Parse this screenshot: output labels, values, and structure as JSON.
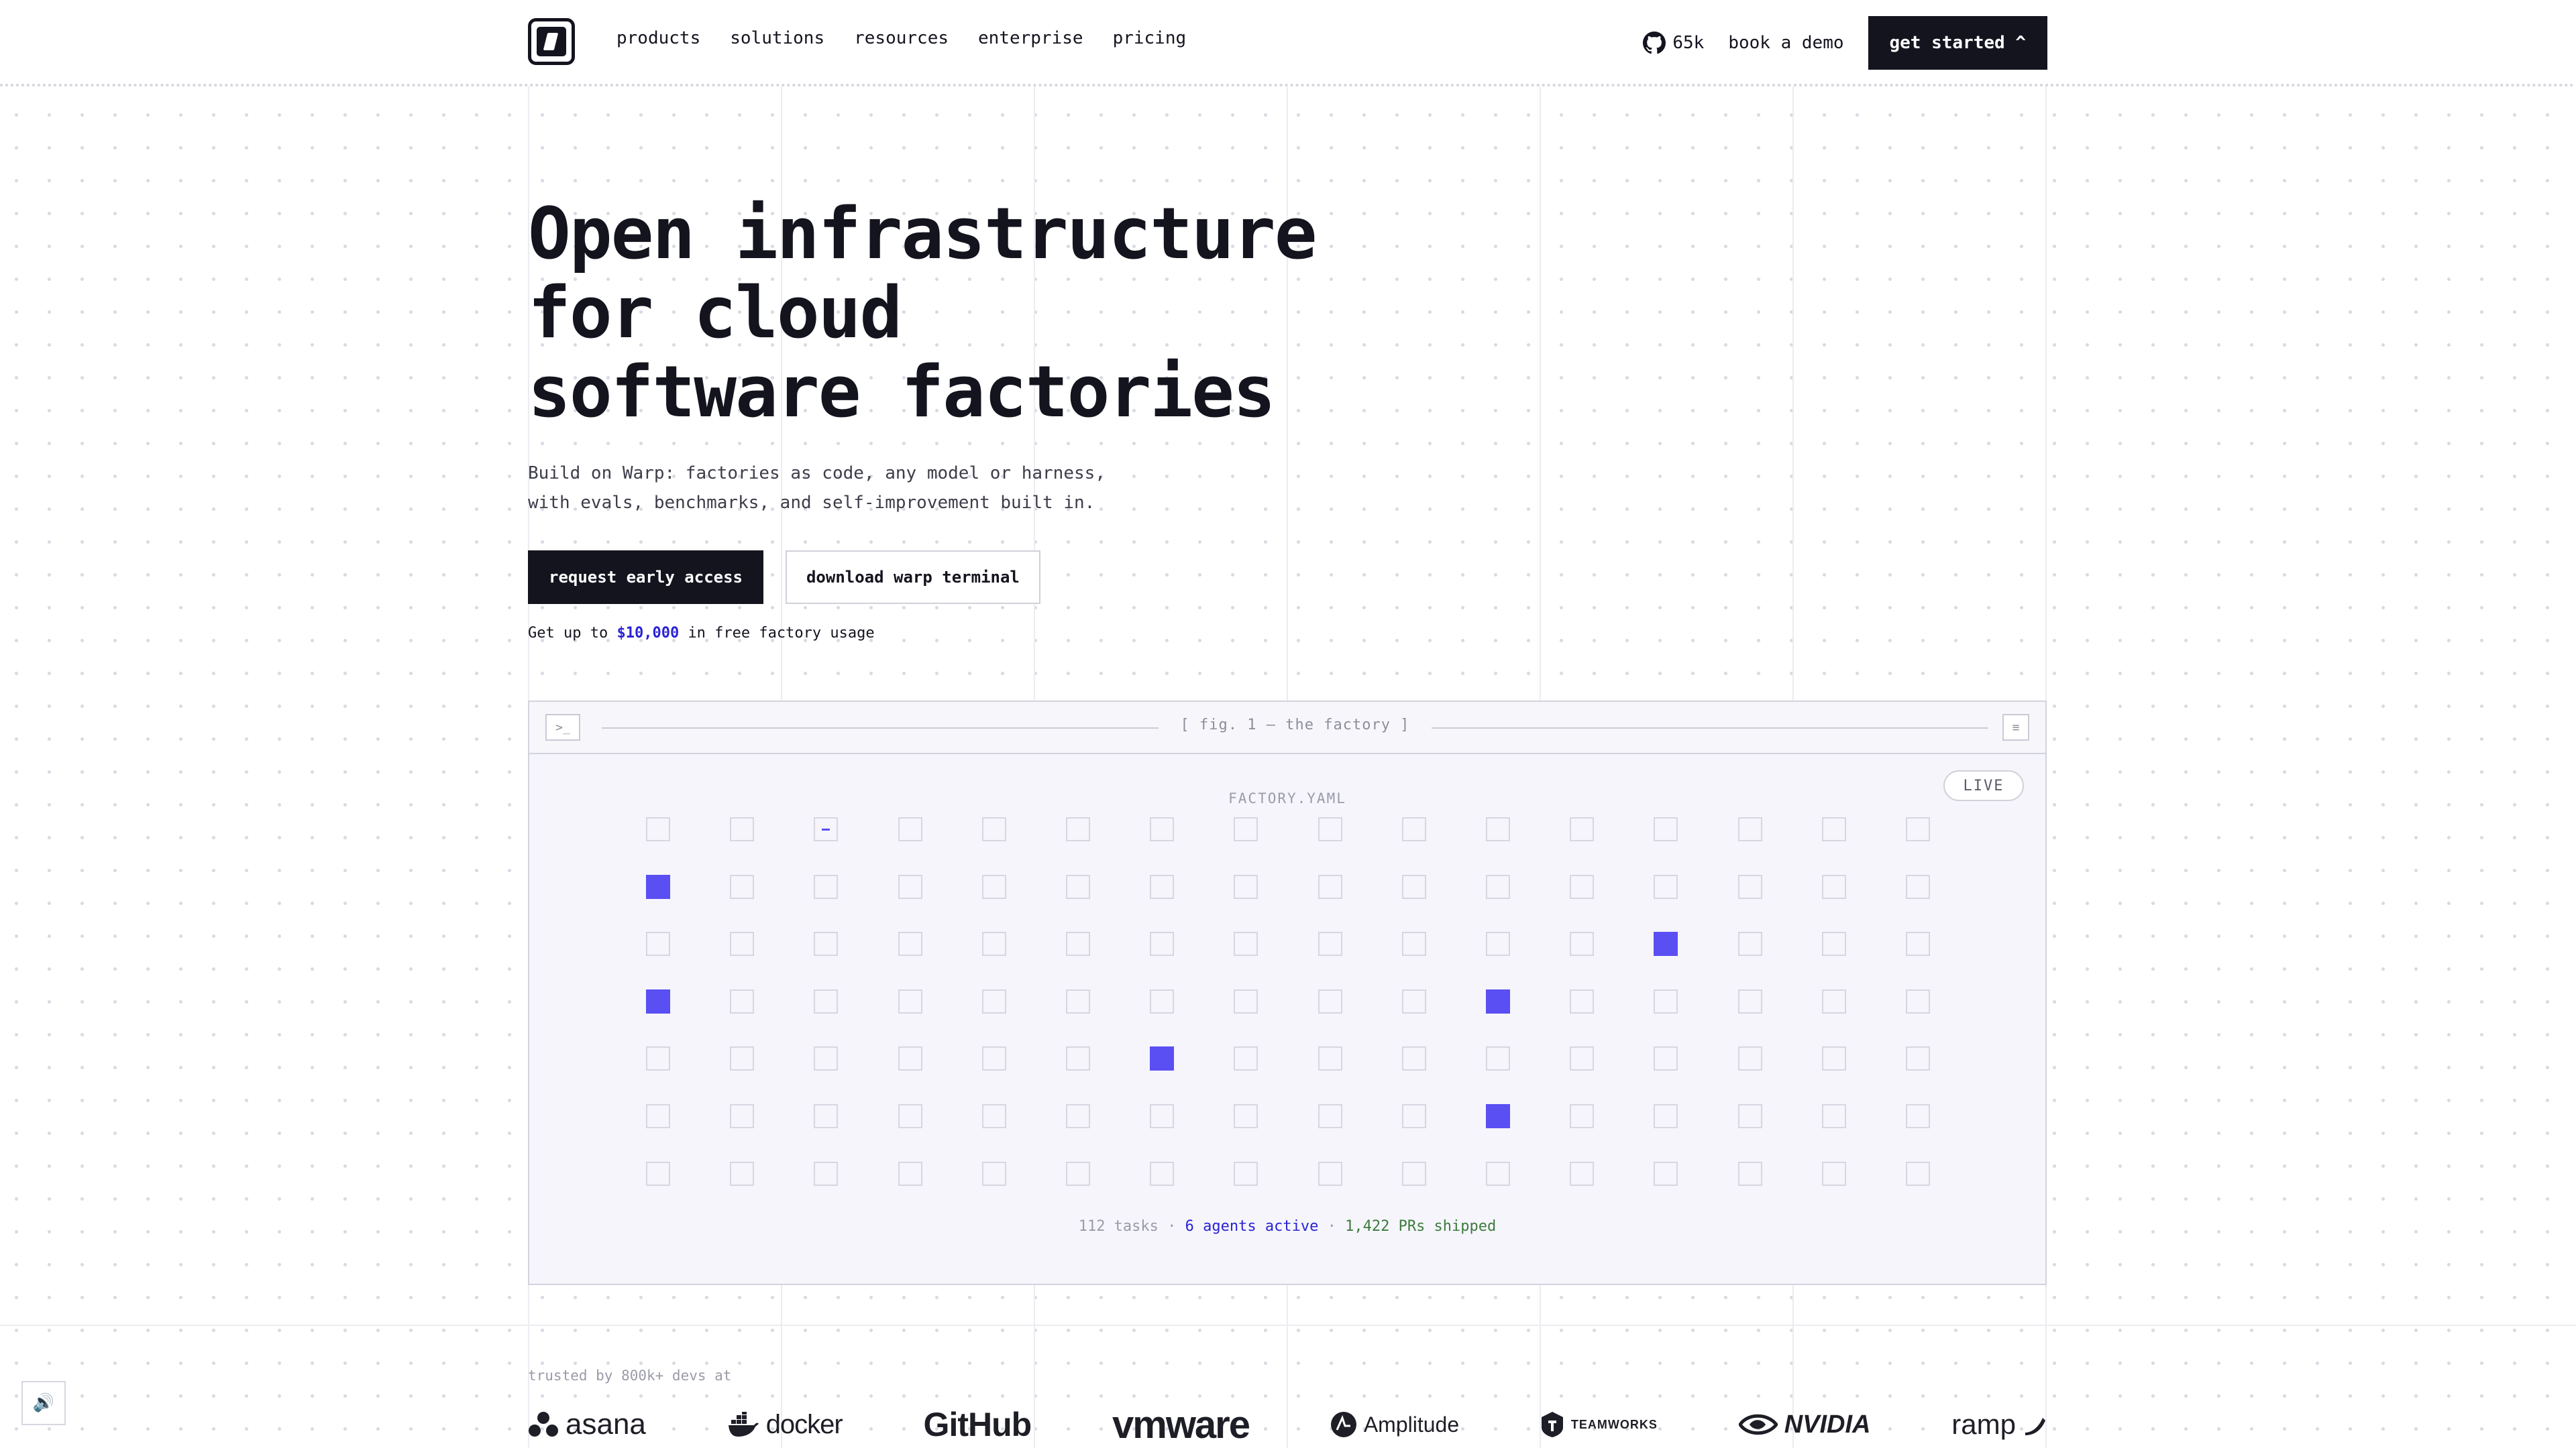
{
  "nav": {
    "menu": [
      "products",
      "solutions",
      "resources",
      "enterprise",
      "pricing"
    ],
    "github_stars": "65k",
    "book_demo": "book a demo",
    "get_started": "get started ^"
  },
  "hero": {
    "title_lines": [
      "Open infrastructure",
      "for cloud",
      "software factories"
    ],
    "subtitle_lines": [
      "Build on Warp: factories as code, any model or harness,",
      "with evals, benchmarks, and self-improvement built in."
    ],
    "primary_cta": "request early access",
    "secondary_cta": "download warp terminal",
    "promo_prefix": "Get up to",
    "promo_amount": "$10,000",
    "promo_suffix": "in free factory usage"
  },
  "figure": {
    "terminal_icon": ">_",
    "title": "[ fig. 1 — the factory ]",
    "menu_icon": "≡",
    "live_badge": "LIVE",
    "file_label": "FACTORY.YAML",
    "grid": {
      "rows": 7,
      "cols": 16,
      "working_cells": [
        [
          0,
          2
        ]
      ],
      "active_cells": [
        [
          1,
          0
        ],
        [
          2,
          12
        ],
        [
          3,
          0
        ],
        [
          3,
          10
        ],
        [
          4,
          6
        ],
        [
          5,
          10
        ]
      ]
    },
    "stats": {
      "tasks": "112 tasks",
      "agents": "6 agents active",
      "prs": "1,422 PRs shipped",
      "sep": "·"
    }
  },
  "trusted": {
    "label": "trusted by 800k+ devs at",
    "logos": [
      "asana",
      "docker",
      "GitHub",
      "vmware",
      "Amplitude",
      "TEAMWORKS",
      "NVIDIA",
      "ramp"
    ]
  },
  "colors": {
    "accent": "#5a4ff3",
    "link": "#2a22d6",
    "dark": "#14141f",
    "green": "#3d7b3d"
  },
  "sound_icon": "🔊"
}
